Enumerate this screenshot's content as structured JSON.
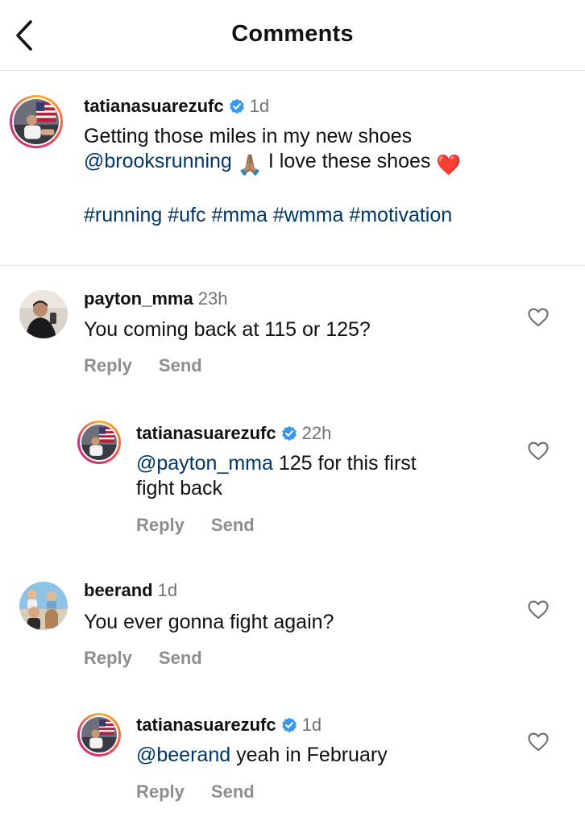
{
  "header": {
    "title": "Comments",
    "back_icon": "chevron-left-icon"
  },
  "caption": {
    "username": "tatianasuarezufc",
    "verified": true,
    "time": "1d",
    "line1": "Getting those miles in my new shoes",
    "mention": "@brooksrunning",
    "emoji_pray": "🙏🏽",
    "after_emoji": "I love these shoes",
    "emoji_heart": "❤️",
    "hashtags": "#running #ufc #mma #wmma #motivation"
  },
  "comments": [
    {
      "username": "payton_mma",
      "time": "23h",
      "text": "You coming back at 115 or 125?",
      "reply_label": "Reply",
      "send_label": "Send",
      "replies": [
        {
          "username": "tatianasuarezufc",
          "verified": true,
          "time": "22h",
          "mention": "@payton_mma",
          "text_line1": "125 for this first",
          "text_line2": "fight back",
          "reply_label": "Reply",
          "send_label": "Send"
        }
      ]
    },
    {
      "username": "beerand",
      "time": "1d",
      "text": "You ever gonna fight again?",
      "reply_label": "Reply",
      "send_label": "Send",
      "replies": [
        {
          "username": "tatianasuarezufc",
          "verified": true,
          "time": "1d",
          "mention": "@beerand",
          "text": "yeah in February",
          "reply_label": "Reply",
          "send_label": "Send"
        }
      ]
    }
  ],
  "colors": {
    "link": "#00376b",
    "verified_badge": "#3897f0",
    "muted": "#8e8e8e",
    "timestamp": "#737373"
  },
  "icons": {
    "like": "heart-outline-icon",
    "verified": "verified-badge-icon"
  }
}
